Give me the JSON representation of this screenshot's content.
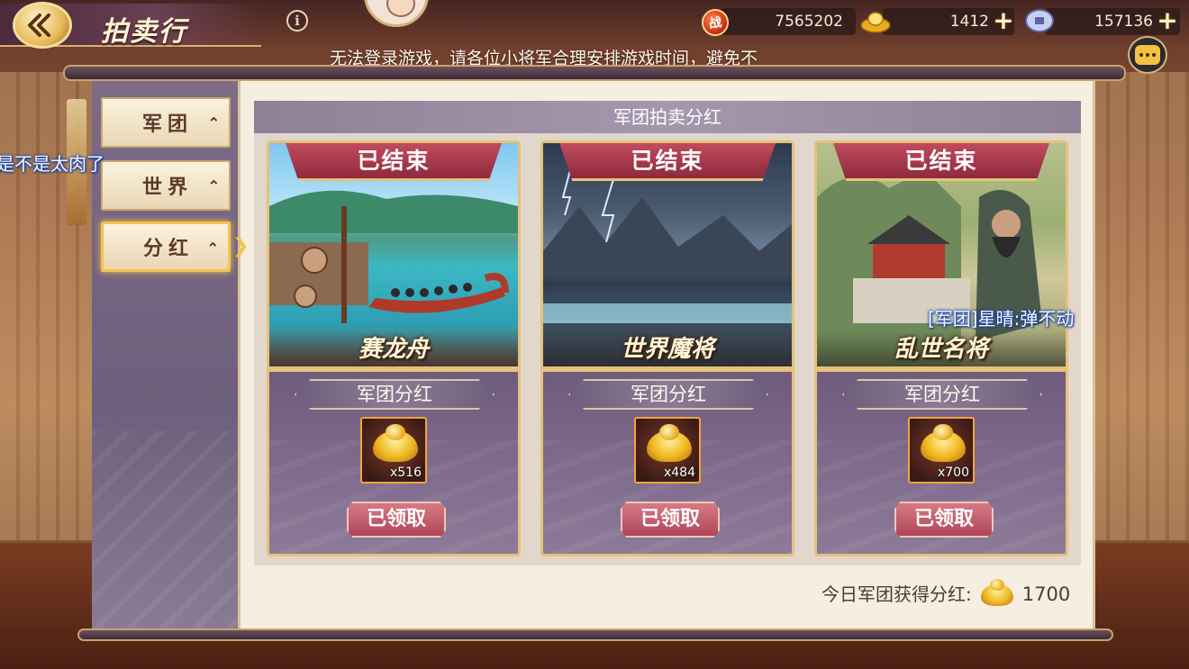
{
  "header": {
    "title": "拍卖行",
    "back_icon": "back-arrow-icon",
    "info_icon": "info-icon"
  },
  "resources": {
    "power": {
      "icon": "battle-power-icon",
      "value": "7565202",
      "icon_text": "战"
    },
    "gold": {
      "icon": "gold-ingot-icon",
      "value": "1412"
    },
    "coin": {
      "icon": "silver-coin-icon",
      "value": "157136"
    },
    "plus_label": "+"
  },
  "marquee": "无法登录游戏，请各位小将军合理安排游戏时间，避免不",
  "chat_floats": {
    "left": "是不是太肉了",
    "right": "[军团]星晴:弹不动"
  },
  "tabs": [
    {
      "label": "军团",
      "chev": "⌃",
      "active": false
    },
    {
      "label": "世界",
      "chev": "⌃",
      "active": false
    },
    {
      "label": "分红",
      "chev": "⌃",
      "active": true
    }
  ],
  "section": {
    "title": "军团拍卖分红"
  },
  "cards": [
    {
      "status": "已结束",
      "name": "赛龙舟",
      "reward_label": "军团分红",
      "reward_icon": "gold-ingot-icon",
      "reward_count": "x516",
      "button": "已领取"
    },
    {
      "status": "已结束",
      "name": "世界魔将",
      "reward_label": "军团分红",
      "reward_icon": "gold-ingot-icon",
      "reward_count": "x484",
      "button": "已领取"
    },
    {
      "status": "已结束",
      "name": "乱世名将",
      "reward_label": "军团分红",
      "reward_icon": "gold-ingot-icon",
      "reward_count": "x700",
      "button": "已领取"
    }
  ],
  "footer": {
    "label": "今日军团获得分红:",
    "value": "1700",
    "icon": "gold-ingot-icon"
  },
  "colors": {
    "accent_gold": "#e6c17a",
    "card_purple": "#7a6684",
    "ribbon_red": "#c24b5e",
    "claim_pink": "#d67a86",
    "chat_blue": "#1a4aa8"
  }
}
